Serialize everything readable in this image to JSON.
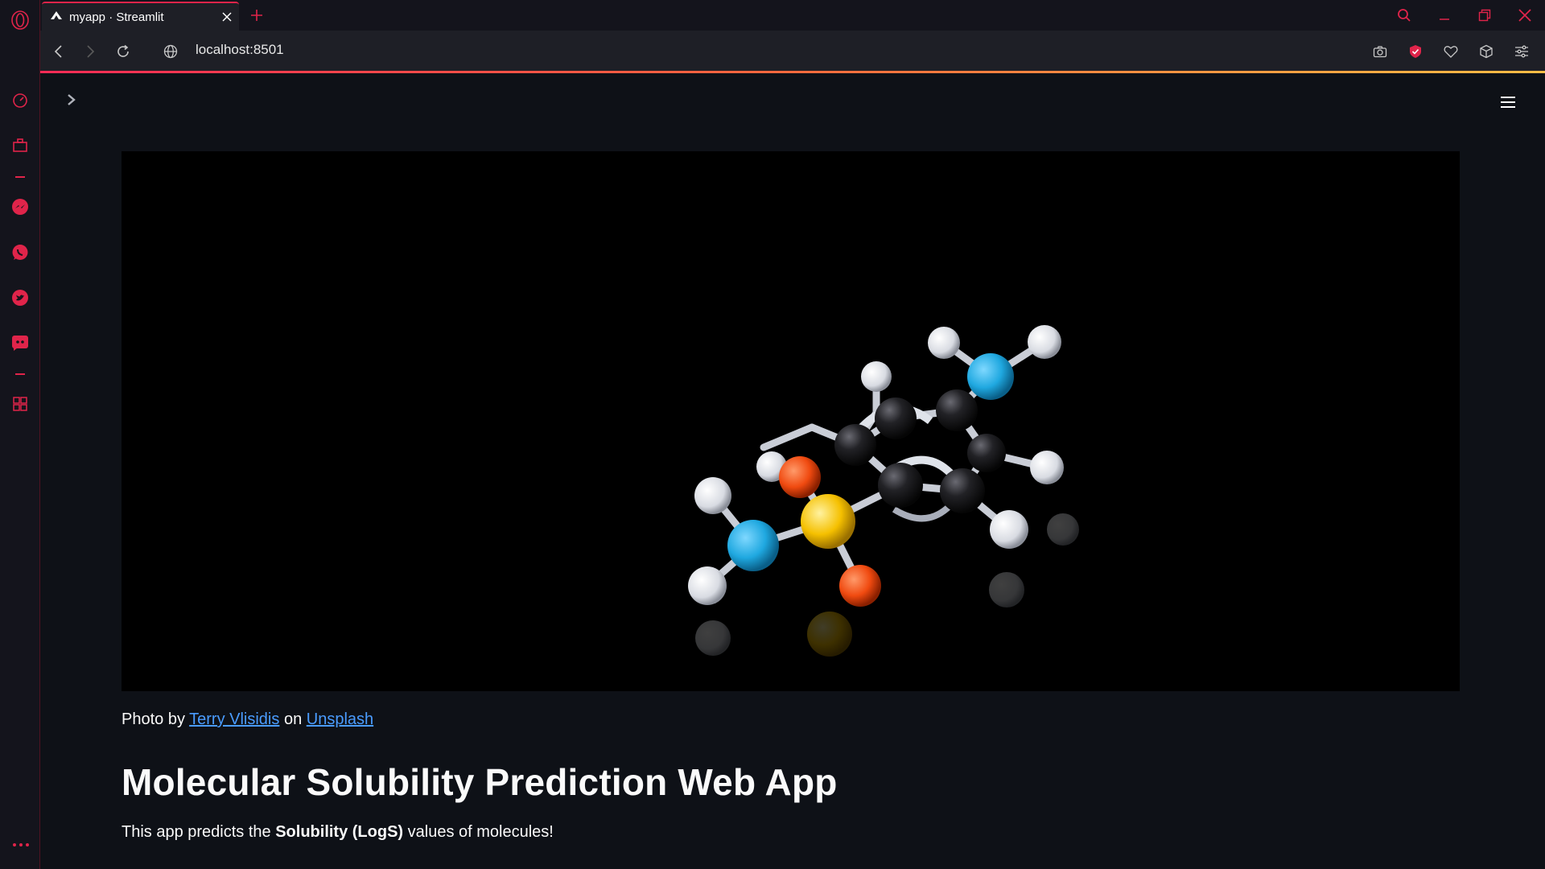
{
  "browser": {
    "tab_title": "myapp · Streamlit",
    "url": "localhost:8501"
  },
  "colors": {
    "accent": "#e0244a",
    "link": "#4a9cff",
    "background": "#0e1117"
  },
  "opera_sidebar": {
    "items": [
      "speed-dial-icon",
      "workspace-icon",
      "messenger-icon",
      "whatsapp-icon",
      "twitter-icon",
      "discord-icon",
      "extensions-icon"
    ]
  },
  "app": {
    "image_caption": {
      "prefix": "Photo by ",
      "author": "Terry Vlisidis",
      "middle": " on ",
      "source": "Unsplash"
    },
    "title": "Molecular Solubility Prediction Web App",
    "description": {
      "before": "This app predicts the ",
      "bold": "Solubility (LogS)",
      "after": " values of molecules!"
    }
  }
}
